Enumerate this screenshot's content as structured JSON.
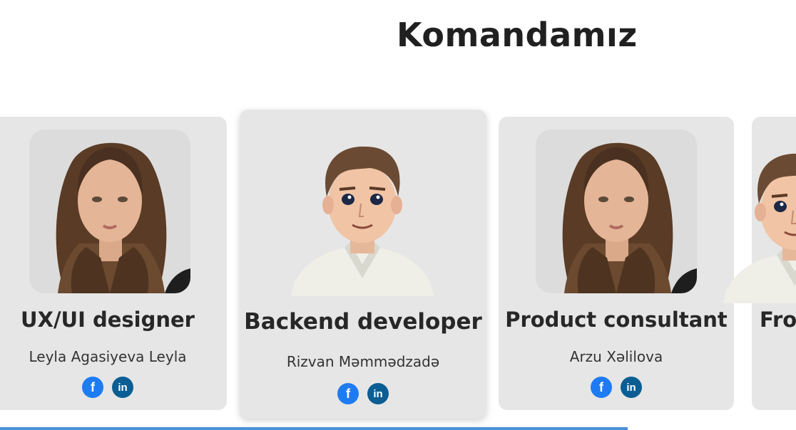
{
  "section": {
    "title": "Komandamız"
  },
  "team": [
    {
      "role": "UX/UI designer",
      "name": "Leyla Agasiyeva Leyla",
      "photo": "woman-portrait"
    },
    {
      "role": "Backend developer",
      "name": "Rizvan Məmmədzadə",
      "photo": "cartoon-man-avatar"
    },
    {
      "role": "Product consultant",
      "name": "Arzu Xəlilova",
      "photo": "woman-portrait"
    },
    {
      "role": "Fro",
      "name": "",
      "photo": "cartoon-man-avatar"
    }
  ],
  "social_icons": {
    "facebook": {
      "glyph": "f",
      "icon": "facebook-icon",
      "color": "#1f7bf2"
    },
    "linkedin": {
      "glyph": "in",
      "icon": "linkedin-icon",
      "color": "#0b5e93"
    }
  },
  "colors": {
    "card_background": "#e6e6e6",
    "title_text": "#202020",
    "scrollbar": "#4a90d9"
  }
}
